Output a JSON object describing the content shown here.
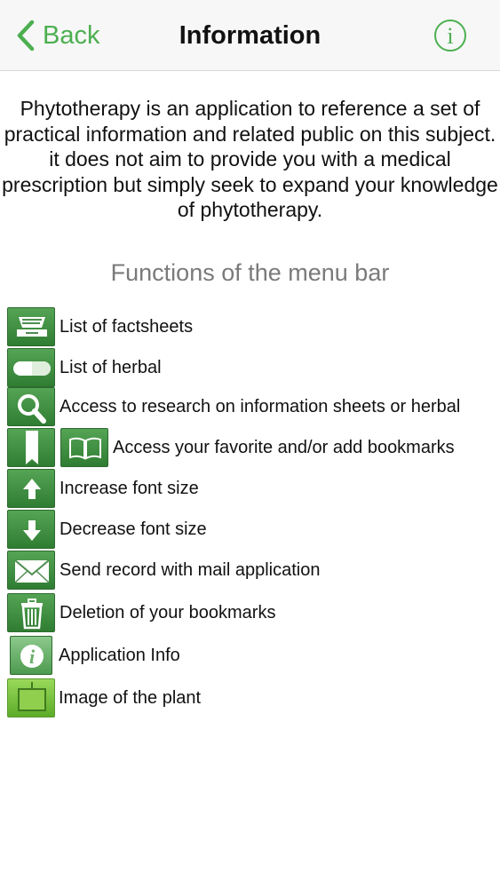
{
  "nav": {
    "back_label": "Back",
    "title": "Information",
    "info_icon": "info-circle-icon",
    "accent_color": "#4caf50"
  },
  "intro_text": "Phytotherapy is an application to reference a set of practical information and related public on this subject. it does not aim to provide you with a medical prescription but simply seek to expand your knowledge of phytotherapy.",
  "section_title": "Functions of the menu bar",
  "menu_functions": [
    {
      "icon": "factsheet-list-icon",
      "label": "List of factsheets"
    },
    {
      "icon": "herbal-capsule-icon",
      "label": "List of herbal"
    },
    {
      "icon": "search-icon",
      "label": "Access to research on information sheets or herbal"
    },
    {
      "icon": "bookmark-icon",
      "icon2": "open-book-icon",
      "label": "Access your favorite and/or add bookmarks"
    },
    {
      "icon": "arrow-up-icon",
      "label": "Increase font size"
    },
    {
      "icon": "arrow-down-icon",
      "label": "Decrease font size"
    },
    {
      "icon": "mail-icon",
      "label": "Send record with mail application"
    },
    {
      "icon": "trash-icon",
      "label": "Deletion of your bookmarks"
    },
    {
      "icon": "info-icon",
      "label": "Application Info"
    },
    {
      "icon": "plant-image-icon",
      "label": "Image of the plant"
    }
  ]
}
